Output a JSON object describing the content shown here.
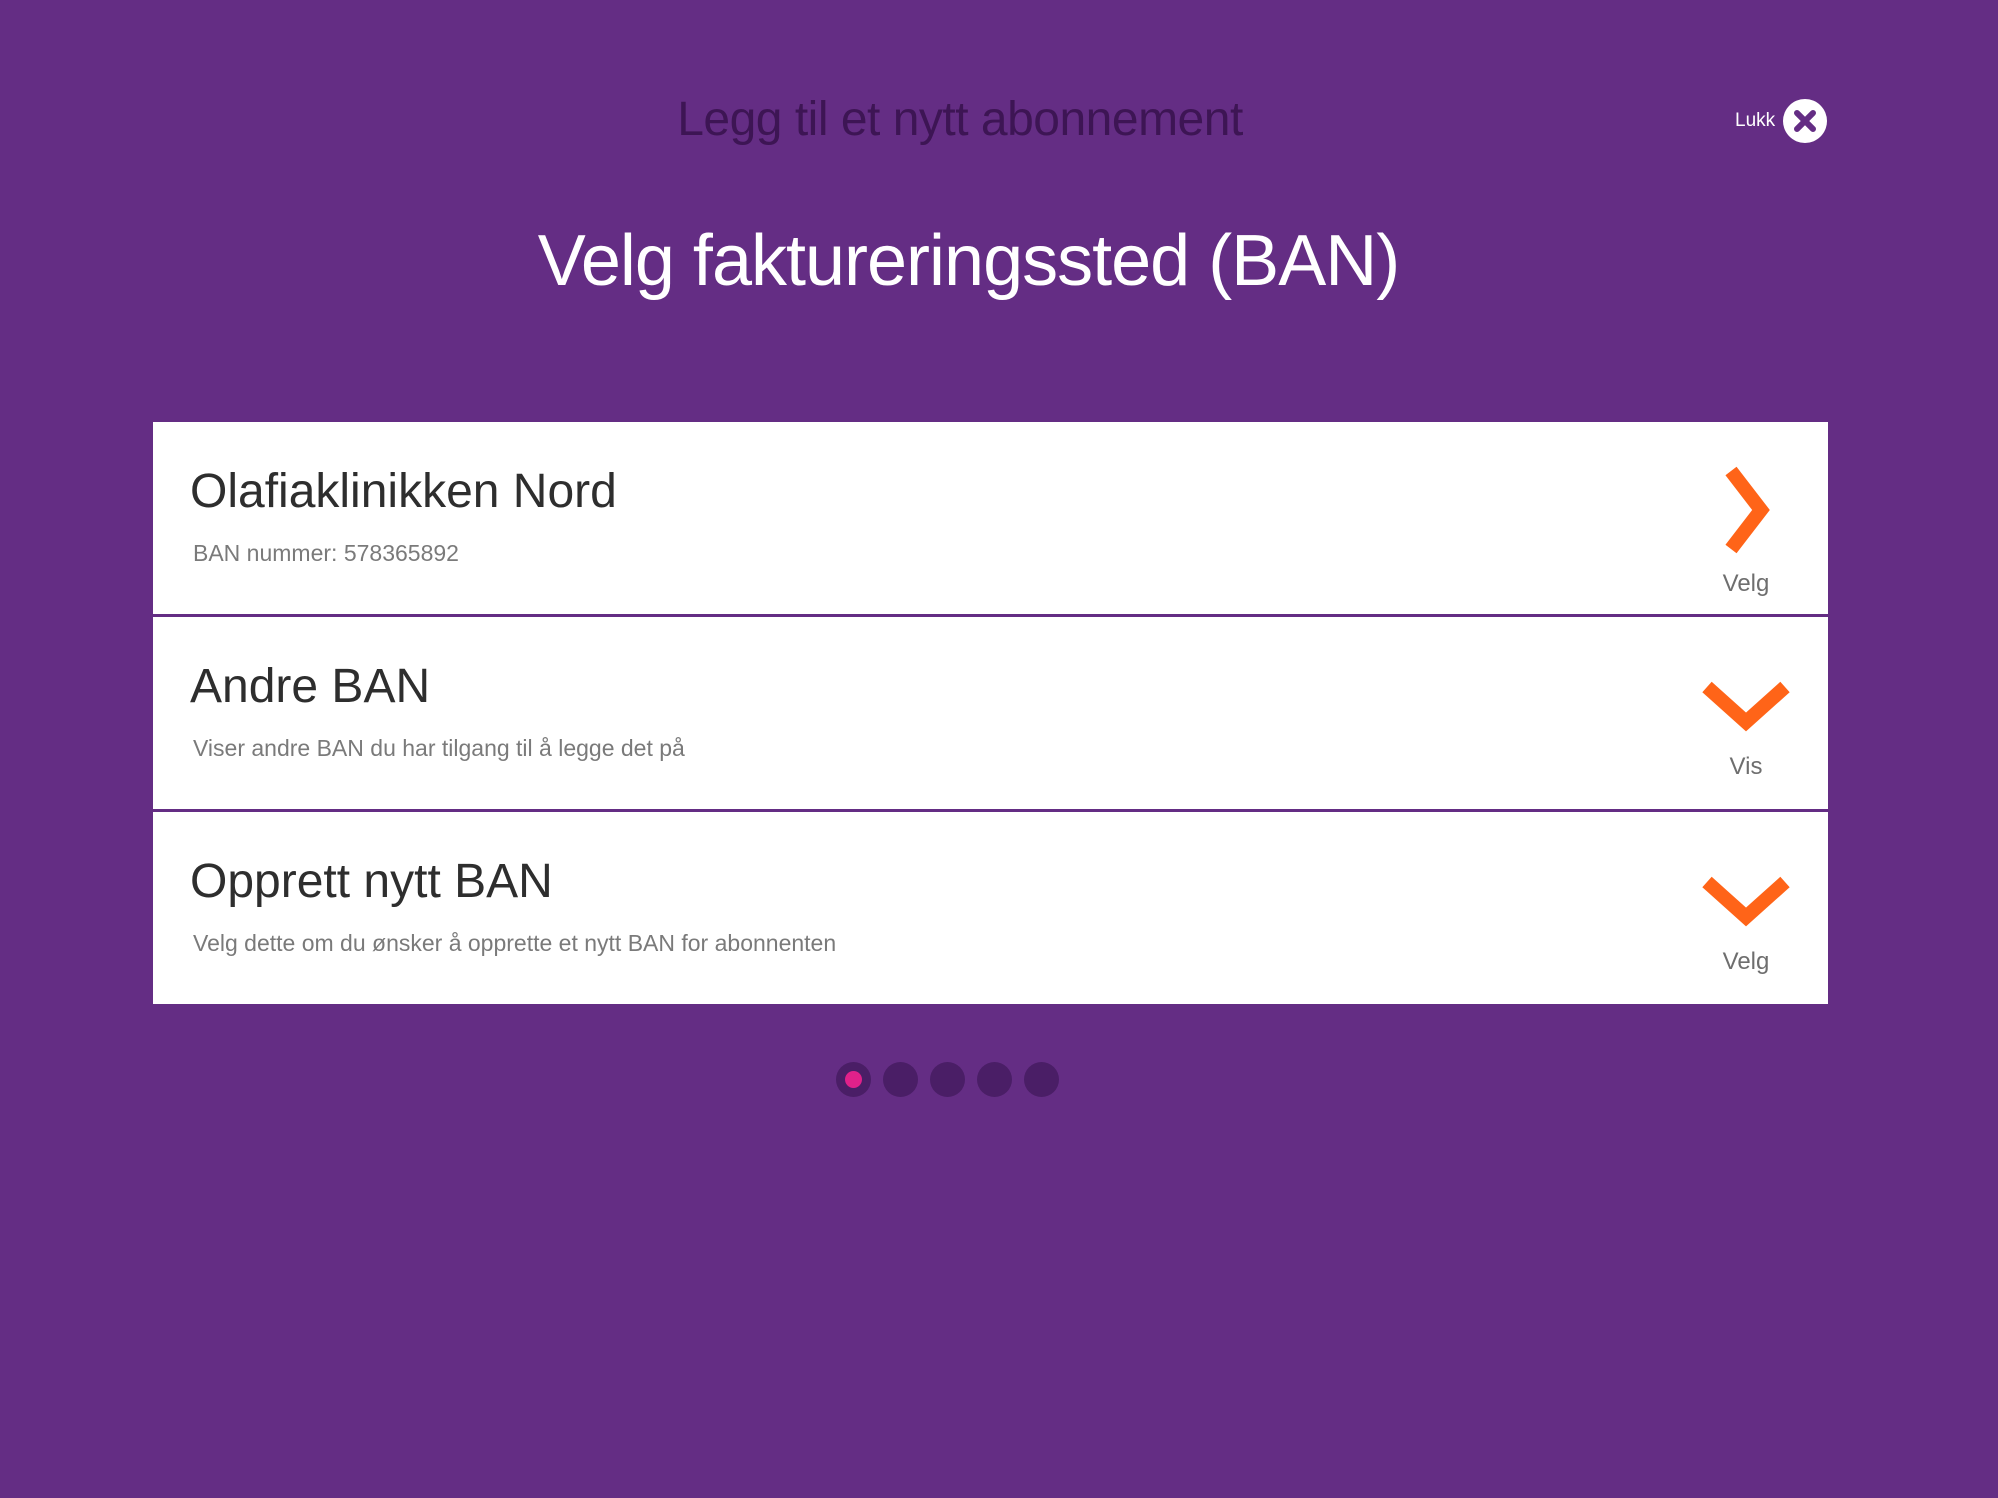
{
  "header": {
    "title": "Legg til et nytt abonnement",
    "close_label": "Lukk",
    "close_icon": "close-icon"
  },
  "page_title": "Velg faktureringssted (BAN)",
  "colors": {
    "background": "#642d84",
    "accent": "#ff6418",
    "active_dot": "#e0218a"
  },
  "options": [
    {
      "title": "Olafiaklinikken Nord",
      "subtitle": "BAN nummer: 578365892",
      "action_label": "Velg",
      "icon": "chevron-right-icon"
    },
    {
      "title": "Andre BAN",
      "subtitle": "Viser andre BAN du har tilgang til å legge det på",
      "action_label": "Vis",
      "icon": "chevron-down-icon"
    },
    {
      "title": "Opprett nytt BAN",
      "subtitle": "Velg dette om du ønsker å opprette et nytt BAN for abonnenten",
      "action_label": "Velg",
      "icon": "chevron-down-icon"
    }
  ],
  "pagination": {
    "total": 5,
    "current": 1
  }
}
